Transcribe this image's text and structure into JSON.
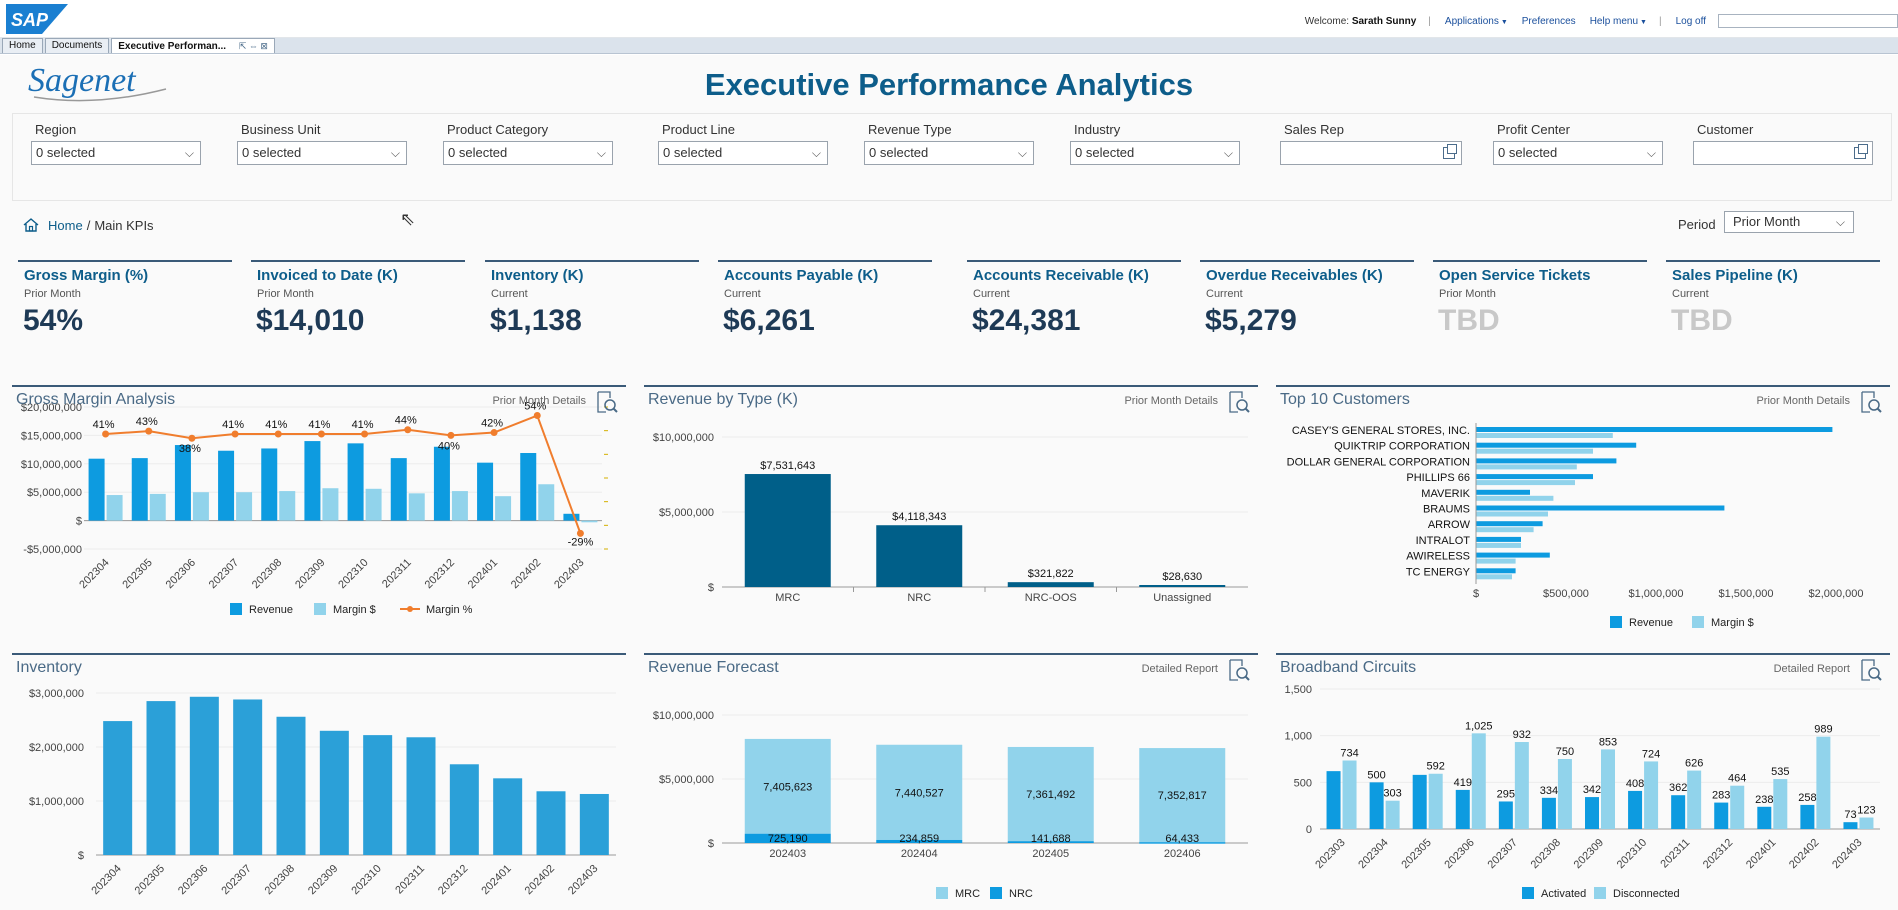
{
  "portal": {
    "logo_text": "SAP",
    "welcome_label": "Welcome:",
    "user_name": "Sarath Sunny",
    "applications": "Applications",
    "preferences": "Preferences",
    "help_menu": "Help menu",
    "log_off": "Log off",
    "tabs": [
      {
        "label": "Home"
      },
      {
        "label": "Documents"
      },
      {
        "label": "Executive Performan..."
      }
    ]
  },
  "brand_logo_text": "Sagenet",
  "title": "Executive Performance Analytics",
  "filters": [
    {
      "label": "Region",
      "value": "0 selected",
      "kind": "dropdown"
    },
    {
      "label": "Business Unit",
      "value": "0 selected",
      "kind": "dropdown"
    },
    {
      "label": "Product Category",
      "value": "0 selected",
      "kind": "dropdown"
    },
    {
      "label": "Product Line",
      "value": "0 selected",
      "kind": "dropdown"
    },
    {
      "label": "Revenue Type",
      "value": "0 selected",
      "kind": "dropdown"
    },
    {
      "label": "Industry",
      "value": "0 selected",
      "kind": "dropdown"
    },
    {
      "label": "Sales Rep",
      "value": "",
      "kind": "valuehelp"
    },
    {
      "label": "Profit Center",
      "value": "0 selected",
      "kind": "dropdown"
    },
    {
      "label": "Customer",
      "value": "",
      "kind": "valuehelp"
    }
  ],
  "breadcrumb": {
    "home": "Home",
    "separator": "/",
    "current": "Main KPIs"
  },
  "period": {
    "label": "Period",
    "value": "Prior Month"
  },
  "kpis": [
    {
      "title": "Gross Margin (%)",
      "sub": "Prior Month",
      "value": "54%"
    },
    {
      "title": "Invoiced to Date (K)",
      "sub": "Prior Month",
      "value": "$14,010"
    },
    {
      "title": "Inventory (K)",
      "sub": "Current",
      "value": "$1,138"
    },
    {
      "title": "Accounts Payable (K)",
      "sub": "Current",
      "value": "$6,261"
    },
    {
      "title": "Accounts Receivable (K)",
      "sub": "Current",
      "value": "$24,381"
    },
    {
      "title": "Overdue Receivables (K)",
      "sub": "Current",
      "value": "$5,279"
    },
    {
      "title": "Open Service Tickets",
      "sub": "Prior Month",
      "value": "TBD"
    },
    {
      "title": "Sales Pipeline (K)",
      "sub": "Current",
      "value": "TBD"
    }
  ],
  "panels": {
    "gross_margin": {
      "title": "Gross Margin Analysis",
      "detail": "Prior Month Details"
    },
    "revenue_type": {
      "title": "Revenue by Type (K)",
      "detail": "Prior Month Details"
    },
    "top_customers": {
      "title": "Top 10 Customers",
      "detail": "Prior Month Details"
    },
    "inventory": {
      "title": "Inventory",
      "detail": ""
    },
    "forecast": {
      "title": "Revenue Forecast",
      "detail": "Detailed Report"
    },
    "broadband": {
      "title": "Broadband Circuits",
      "detail": "Detailed Report"
    }
  },
  "colors": {
    "dark": "#005f89",
    "mid": "#0d9be0",
    "light": "#91d3eb",
    "line": "#f07d2d",
    "inv": "#2ba0d8"
  },
  "chart_data": [
    {
      "id": "gross_margin",
      "type": "bar",
      "categories": [
        "202304",
        "202305",
        "202306",
        "202307",
        "202308",
        "202309",
        "202310",
        "202311",
        "202312",
        "202401",
        "202402",
        "202403"
      ],
      "yticks": [
        "$20,000,000",
        "$15,000,000",
        "$10,000,000",
        "$5,000,000",
        "$",
        "-$5,000,000"
      ],
      "ylim": [
        -5000000,
        20000000
      ],
      "series": [
        {
          "name": "Revenue",
          "values": [
            10900000,
            11000000,
            13300000,
            12300000,
            12700000,
            14000000,
            13600000,
            11000000,
            13000000,
            10200000,
            11900000,
            1200000
          ]
        },
        {
          "name": "Margin $",
          "values": [
            4500000,
            4700000,
            5000000,
            5000000,
            5200000,
            5700000,
            5600000,
            4800000,
            5200000,
            4300000,
            6400000,
            -300000
          ]
        },
        {
          "name": "Margin %",
          "values": [
            41,
            43,
            38,
            41,
            41,
            41,
            41,
            44,
            40,
            42,
            54,
            -29
          ],
          "labels": [
            "41%",
            "43%",
            "38%",
            "41%",
            "41%",
            "41%",
            "41%",
            "44%",
            "40%",
            "42%",
            "54%",
            "-29%"
          ]
        }
      ]
    },
    {
      "id": "revenue_type",
      "type": "bar",
      "categories": [
        "MRC",
        "NRC",
        "NRC-OOS",
        "Unassigned"
      ],
      "values": [
        7531643,
        4118343,
        321822,
        28630
      ],
      "labels": [
        "$7,531,643",
        "$4,118,343",
        "$321,822",
        "$28,630"
      ],
      "yticks": [
        "$10,000,000",
        "$5,000,000",
        "$"
      ],
      "ylim": [
        0,
        10000000
      ]
    },
    {
      "id": "top_customers",
      "type": "bar",
      "categories": [
        "CASEY'S GENERAL STORES, INC.",
        "QUIKTRIP CORPORATION",
        "DOLLAR GENERAL CORPORATION",
        "PHILLIPS 66",
        "MAVERIK",
        "BRAUMS",
        "ARROW",
        "INTRALOT",
        "AWIRELESS",
        "TC ENERGY"
      ],
      "xticks": [
        "$",
        "$500,000",
        "$1,000,000",
        "$1,500,000",
        "$2,000,000"
      ],
      "xlim": [
        0,
        2000000
      ],
      "series": [
        {
          "name": "Revenue",
          "values": [
            1980000,
            890000,
            780000,
            650000,
            300000,
            1380000,
            370000,
            250000,
            410000,
            220000
          ]
        },
        {
          "name": "Margin $",
          "values": [
            760000,
            650000,
            560000,
            550000,
            430000,
            400000,
            320000,
            250000,
            220000,
            200000
          ]
        }
      ]
    },
    {
      "id": "inventory",
      "type": "bar",
      "categories": [
        "202304",
        "202305",
        "202306",
        "202307",
        "202308",
        "202309",
        "202310",
        "202311",
        "202312",
        "202401",
        "202402",
        "202403"
      ],
      "values": [
        2480000,
        2850000,
        2930000,
        2880000,
        2560000,
        2300000,
        2220000,
        2180000,
        1680000,
        1420000,
        1180000,
        1130000
      ],
      "yticks": [
        "$3,000,000",
        "$2,000,000",
        "$1,000,000",
        "$"
      ],
      "ylim": [
        0,
        3000000
      ]
    },
    {
      "id": "forecast",
      "type": "bar",
      "categories": [
        "202403",
        "202404",
        "202405",
        "202406"
      ],
      "yticks": [
        "$10,000,000",
        "$5,000,000",
        "$"
      ],
      "ylim": [
        0,
        10000000
      ],
      "series": [
        {
          "name": "MRC",
          "values": [
            7405623,
            7440527,
            7361492,
            7352817
          ],
          "labels": [
            "7,405,623",
            "7,440,527",
            "7,361,492",
            "7,352,817"
          ]
        },
        {
          "name": "NRC",
          "values": [
            725190,
            234859,
            141688,
            64433
          ],
          "labels": [
            "725,190",
            "234,859",
            "141,688",
            "64,433"
          ]
        }
      ]
    },
    {
      "id": "broadband",
      "type": "bar",
      "categories": [
        "202303",
        "202304",
        "202305",
        "202306",
        "202307",
        "202308",
        "202309",
        "202310",
        "202311",
        "202312",
        "202401",
        "202402",
        "202403"
      ],
      "yticks": [
        "1,500",
        "1,000",
        "500",
        "0"
      ],
      "ylim": [
        0,
        1500
      ],
      "series": [
        {
          "name": "Activated",
          "values": [
            620,
            500,
            580,
            419,
            295,
            334,
            342,
            408,
            362,
            283,
            238,
            258,
            73
          ],
          "labels": [
            "",
            "500",
            "",
            "419",
            "295",
            "334",
            "342",
            "408",
            "362",
            "283",
            "238",
            "258",
            "73"
          ]
        },
        {
          "name": "Disconnected",
          "values": [
            734,
            303,
            592,
            1025,
            932,
            750,
            853,
            724,
            626,
            464,
            535,
            989,
            123
          ],
          "labels": [
            "734",
            "303",
            "592",
            "1,025",
            "932",
            "750",
            "853",
            "724",
            "626",
            "464",
            "535",
            "989",
            "123"
          ]
        }
      ]
    }
  ]
}
